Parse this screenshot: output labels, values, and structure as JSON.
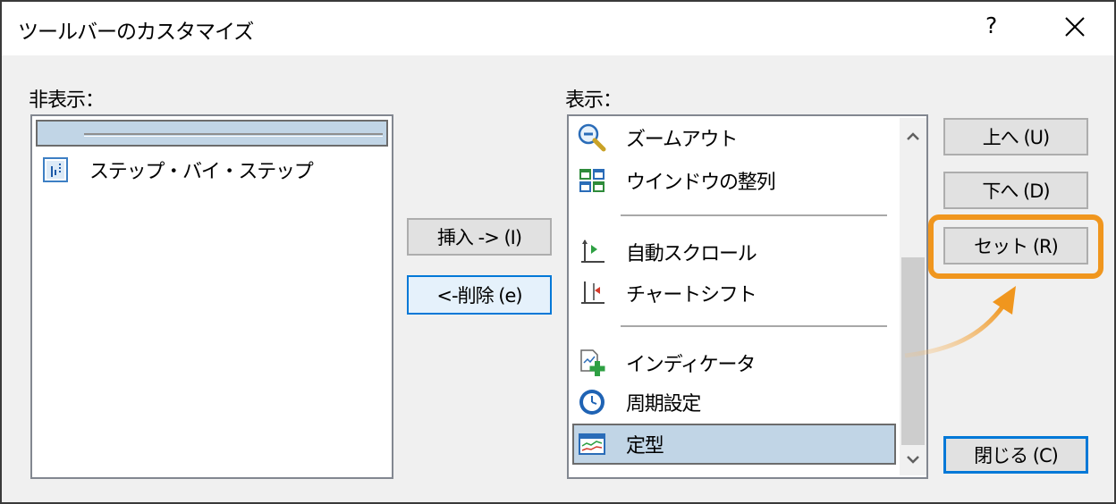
{
  "window": {
    "title": "ツールバーのカスタマイズ",
    "help": "?",
    "close": "✕"
  },
  "hidden": {
    "label": "非表示：",
    "items": [
      {
        "label": "ステップ・バイ・ステップ",
        "icon": "step-by-step-icon"
      }
    ]
  },
  "shown": {
    "label": "表示：",
    "items": [
      {
        "label": "ズームアウト",
        "icon": "zoom-out-icon"
      },
      {
        "label": "ウインドウの整列",
        "icon": "tile-windows-icon"
      },
      {
        "label": "自動スクロール",
        "icon": "auto-scroll-icon"
      },
      {
        "label": "チャートシフト",
        "icon": "chart-shift-icon"
      },
      {
        "label": "インディケータ",
        "icon": "indicator-add-icon"
      },
      {
        "label": "周期設定",
        "icon": "clock-icon"
      },
      {
        "label": "定型",
        "icon": "template-icon"
      }
    ]
  },
  "buttons": {
    "insert": "挿入 -> (I)",
    "remove": "<-削除 (e)",
    "up": "上へ (U)",
    "down": "下へ (D)",
    "reset": "セット (R)",
    "close": "閉じる (C)"
  },
  "colors": {
    "selection": "#c1d5e6",
    "focus_border": "#0078d7",
    "highlight": "#f0961e"
  }
}
